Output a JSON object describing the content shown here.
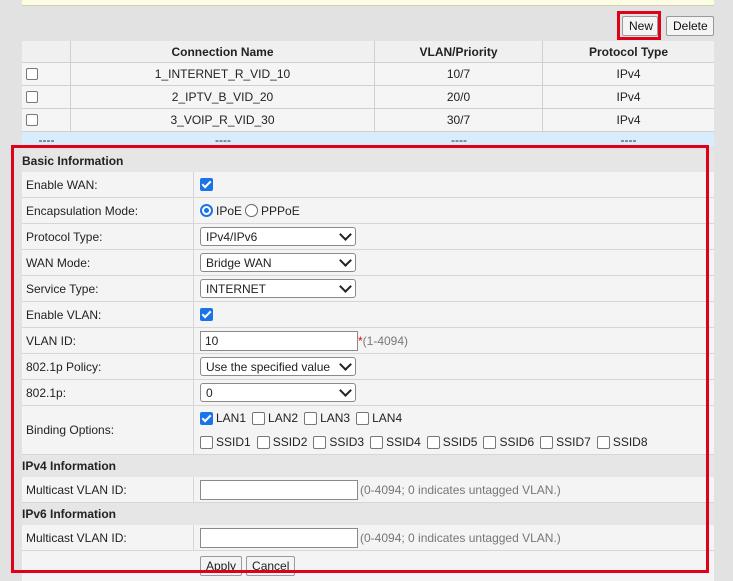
{
  "toolbar": {
    "new_label": "New",
    "delete_label": "Delete"
  },
  "connections": {
    "headers": [
      "Connection Name",
      "VLAN/Priority",
      "Protocol Type"
    ],
    "rows": [
      {
        "name": "1_INTERNET_R_VID_10",
        "vlan": "10/7",
        "protocol": "IPv4"
      },
      {
        "name": "2_IPTV_B_VID_20",
        "vlan": "20/0",
        "protocol": "IPv4"
      },
      {
        "name": "3_VOIP_R_VID_30",
        "vlan": "30/7",
        "protocol": "IPv4"
      }
    ],
    "new_row": [
      "----",
      "----",
      "----",
      "----"
    ]
  },
  "basic": {
    "title": "Basic Information",
    "enable_wan": {
      "label": "Enable WAN:",
      "checked": true
    },
    "encap": {
      "label": "Encapsulation Mode:",
      "options": [
        "IPoE",
        "PPPoE"
      ],
      "selected": "IPoE"
    },
    "protocol": {
      "label": "Protocol Type:",
      "value": "IPv4/IPv6"
    },
    "wan_mode": {
      "label": "WAN Mode:",
      "value": "Bridge WAN"
    },
    "service": {
      "label": "Service Type:",
      "value": "INTERNET"
    },
    "enable_vlan": {
      "label": "Enable VLAN:",
      "checked": true
    },
    "vlan_id": {
      "label": "VLAN ID:",
      "value": "10",
      "required": "*",
      "hint": "(1-4094)"
    },
    "policy": {
      "label": "802.1p Policy:",
      "value": "Use the specified value"
    },
    "p8021": {
      "label": "802.1p:",
      "value": "0"
    },
    "binding": {
      "label": "Binding Options:",
      "lan": [
        {
          "label": "LAN1",
          "checked": true
        },
        {
          "label": "LAN2",
          "checked": false
        },
        {
          "label": "LAN3",
          "checked": false
        },
        {
          "label": "LAN4",
          "checked": false
        }
      ],
      "ssid": [
        "SSID1",
        "SSID2",
        "SSID3",
        "SSID4",
        "SSID5",
        "SSID6",
        "SSID7",
        "SSID8"
      ]
    }
  },
  "ipv4": {
    "title": "IPv4 Information",
    "mcast": {
      "label": "Multicast VLAN ID:",
      "value": "",
      "hint": "(0-4094; 0 indicates untagged VLAN.)"
    }
  },
  "ipv6": {
    "title": "IPv6 Information",
    "mcast": {
      "label": "Multicast VLAN ID:",
      "value": "",
      "hint": "(0-4094; 0 indicates untagged VLAN.)"
    }
  },
  "actions": {
    "apply_label": "Apply",
    "cancel_label": "Cancel"
  },
  "colors": {
    "highlight": "#e0001a",
    "check": "#1a73e8",
    "new_row": "#d9ecfb"
  }
}
